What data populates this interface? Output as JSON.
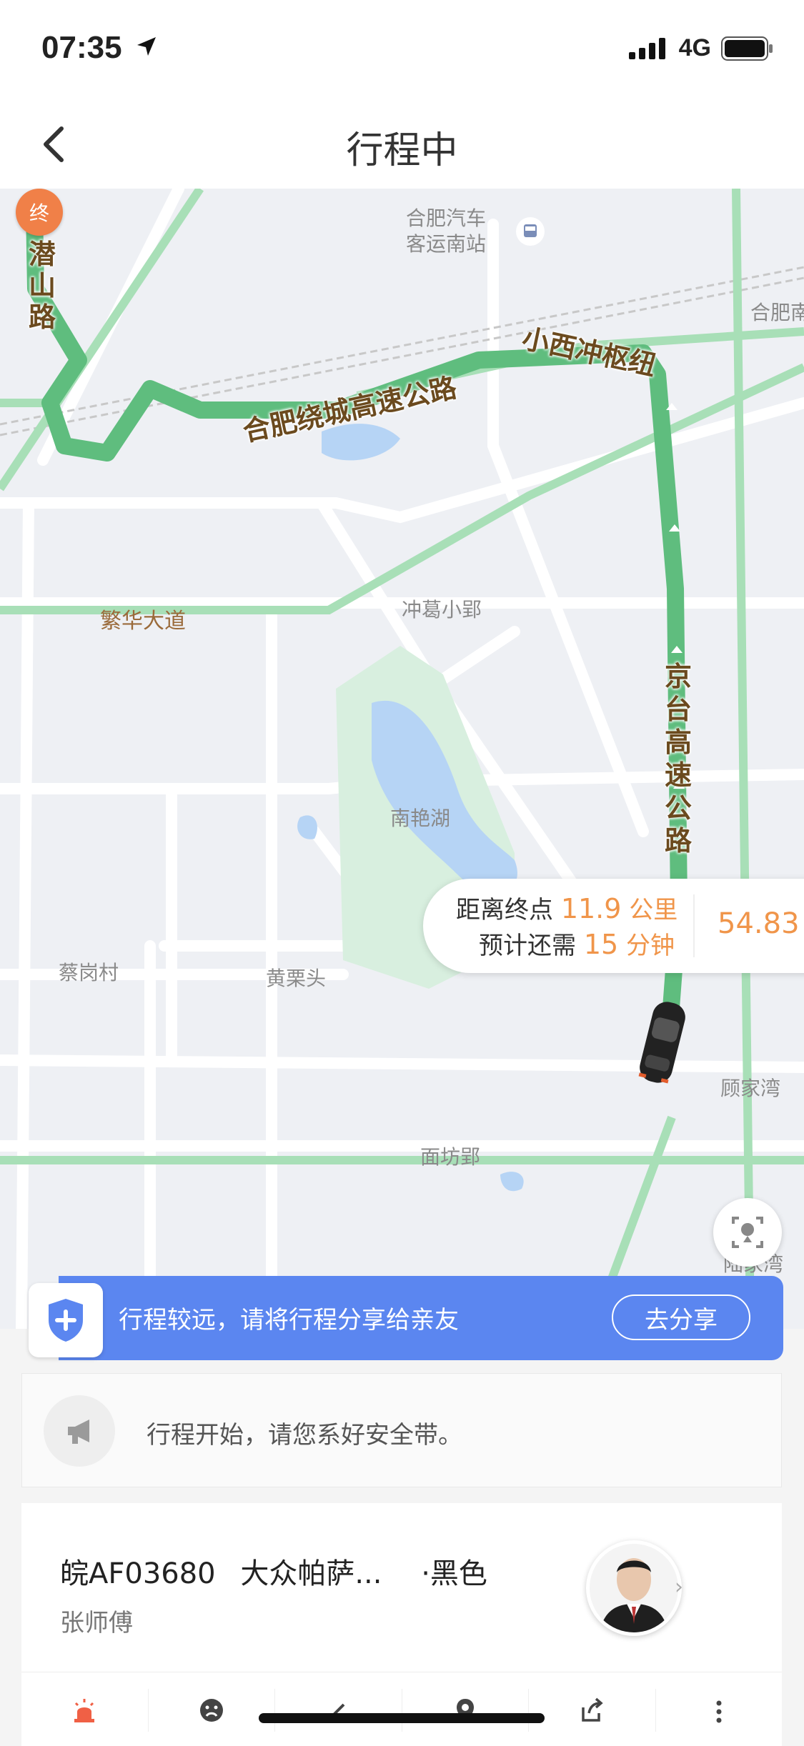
{
  "status_bar": {
    "time": "07:35",
    "network": "4G"
  },
  "nav": {
    "title": "行程中",
    "back_icon": "chevron-left-icon"
  },
  "map": {
    "end_marker": "终",
    "labels": {
      "hefei_bus_station_1": "合肥汽车",
      "hefei_bus_station_2": "客运南站",
      "hefei_partial": "合肥南",
      "fanhua_avenue": "繁华大道",
      "chonggexiaoying": "冲葛小郢",
      "nanyanhu": "南艳湖",
      "caigangcun": "蔡岗村",
      "huangsutou": "黄栗头",
      "gujiawan": "顾家湾",
      "mianfangying": "面坊郢",
      "lujiawan": "陆家湾"
    },
    "roads": {
      "qianshan_road": "潜山路",
      "ring_expressway": "合肥绕城高速公路",
      "xiaoxichong_hub": "小西冲枢纽",
      "jingtai_expressway": "京台高速公路"
    },
    "colors": {
      "route": "#5fbd7e",
      "highway": "#a8dfb7",
      "water": "#b6d4f5",
      "park": "#d8efdf"
    }
  },
  "trip_info": {
    "distance_prefix": "距离终点",
    "distance_value": "11.9",
    "distance_unit": "公里",
    "time_prefix": "预计还需",
    "time_value": "15",
    "time_unit": "分钟",
    "fare": "54.83"
  },
  "share_banner": {
    "text": "行程较远，请将行程分享给亲友",
    "button": "去分享",
    "color": "#5b86f0"
  },
  "notice": {
    "text": "行程开始，请您系好安全带。"
  },
  "driver": {
    "plate": "皖AF03680",
    "car_model": "大众帕萨...",
    "car_color": "·黑色",
    "name": "张师傅"
  },
  "actions": [
    "alarm-icon",
    "frown-icon",
    "edit-icon",
    "location-icon",
    "share-icon",
    "more-icon"
  ],
  "accent_color": "#f0954a"
}
